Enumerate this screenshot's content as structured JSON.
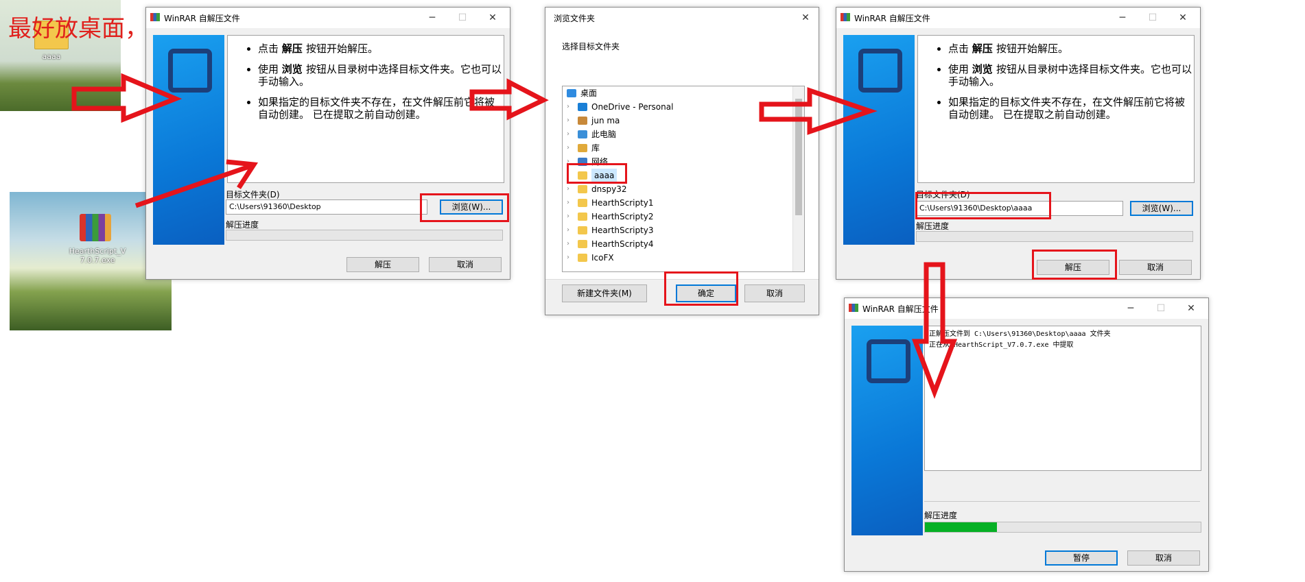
{
  "annotation": {
    "note": "最好放桌面，纯英文"
  },
  "desktop": {
    "folder_label": "aaaa",
    "file_label": "HearthScript_V7.0.7.exe"
  },
  "dialog1": {
    "title": "WinRAR 自解压文件",
    "instructions": [
      {
        "pre": "点击 ",
        "bold": "解压",
        "post": " 按钮开始解压。"
      },
      {
        "pre": "使用 ",
        "bold": "浏览",
        "post": " 按钮从目录树中选择目标文件夹。它也可以手动输入。"
      },
      {
        "pre": "如果指定的目标文件夹不存在，在文件解压前它将被自动创建。 已在提取之前自动创建。",
        "bold": "",
        "post": ""
      }
    ],
    "dest_label": "目标文件夹(D)",
    "dest_value": "C:\\Users\\91360\\Desktop",
    "browse_label": "浏览(W)...",
    "progress_label": "解压进度",
    "extract_label": "解压",
    "cancel_label": "取消"
  },
  "browse_dialog": {
    "title": "浏览文件夹",
    "prompt": "选择目标文件夹",
    "tree": [
      {
        "label": "桌面",
        "icon": "desktop-icon",
        "color": "#2f8be0",
        "level": 0,
        "expander": false
      },
      {
        "label": "OneDrive - Personal",
        "icon": "onedrive-icon",
        "color": "#1a7fd6",
        "level": 1,
        "expander": true
      },
      {
        "label": "jun ma",
        "icon": "user-icon",
        "color": "#c8893a",
        "level": 1,
        "expander": true
      },
      {
        "label": "此电脑",
        "icon": "computer-icon",
        "color": "#3a8fd8",
        "level": 1,
        "expander": true
      },
      {
        "label": "库",
        "icon": "library-icon",
        "color": "#e0a93a",
        "level": 1,
        "expander": true
      },
      {
        "label": "网络",
        "icon": "network-icon",
        "color": "#3a7bc8",
        "level": 1,
        "expander": true
      },
      {
        "label": "aaaa",
        "icon": "folder-icon",
        "color": "#f3c74c",
        "level": 1,
        "expander": false,
        "selected": true
      },
      {
        "label": "dnspy32",
        "icon": "folder-icon",
        "color": "#f3c74c",
        "level": 1,
        "expander": true
      },
      {
        "label": "HearthScripty1",
        "icon": "folder-icon",
        "color": "#f3c74c",
        "level": 1,
        "expander": true
      },
      {
        "label": "HearthScripty2",
        "icon": "folder-icon",
        "color": "#f3c74c",
        "level": 1,
        "expander": true
      },
      {
        "label": "HearthScripty3",
        "icon": "folder-icon",
        "color": "#f3c74c",
        "level": 1,
        "expander": true
      },
      {
        "label": "HearthScripty4",
        "icon": "folder-icon",
        "color": "#f3c74c",
        "level": 1,
        "expander": true
      },
      {
        "label": "IcoFX",
        "icon": "folder-icon",
        "color": "#f3c74c",
        "level": 1,
        "expander": true
      }
    ],
    "new_folder_label": "新建文件夹(M)",
    "ok_label": "确定",
    "cancel_label": "取消"
  },
  "dialog2": {
    "title": "WinRAR 自解压文件",
    "dest_label": "目标文件夹(D)",
    "dest_value": "C:\\Users\\91360\\Desktop\\aaaa",
    "browse_label": "浏览(W)...",
    "progress_label": "解压进度",
    "extract_label": "解压",
    "cancel_label": "取消"
  },
  "dialog3": {
    "title": "WinRAR 自解压文件",
    "log_line1": "正解压文件到 C:\\Users\\91360\\Desktop\\aaaa 文件夹",
    "log_line2": "正在从 HearthScript_V7.0.7.exe 中提取",
    "progress_label": "解压进度",
    "progress_value": 0.26,
    "pause_label": "暂停",
    "cancel_label": "取消"
  },
  "colors": {
    "highlight": "#e5141b",
    "progress": "#06b025",
    "accent": "#0078d7"
  }
}
